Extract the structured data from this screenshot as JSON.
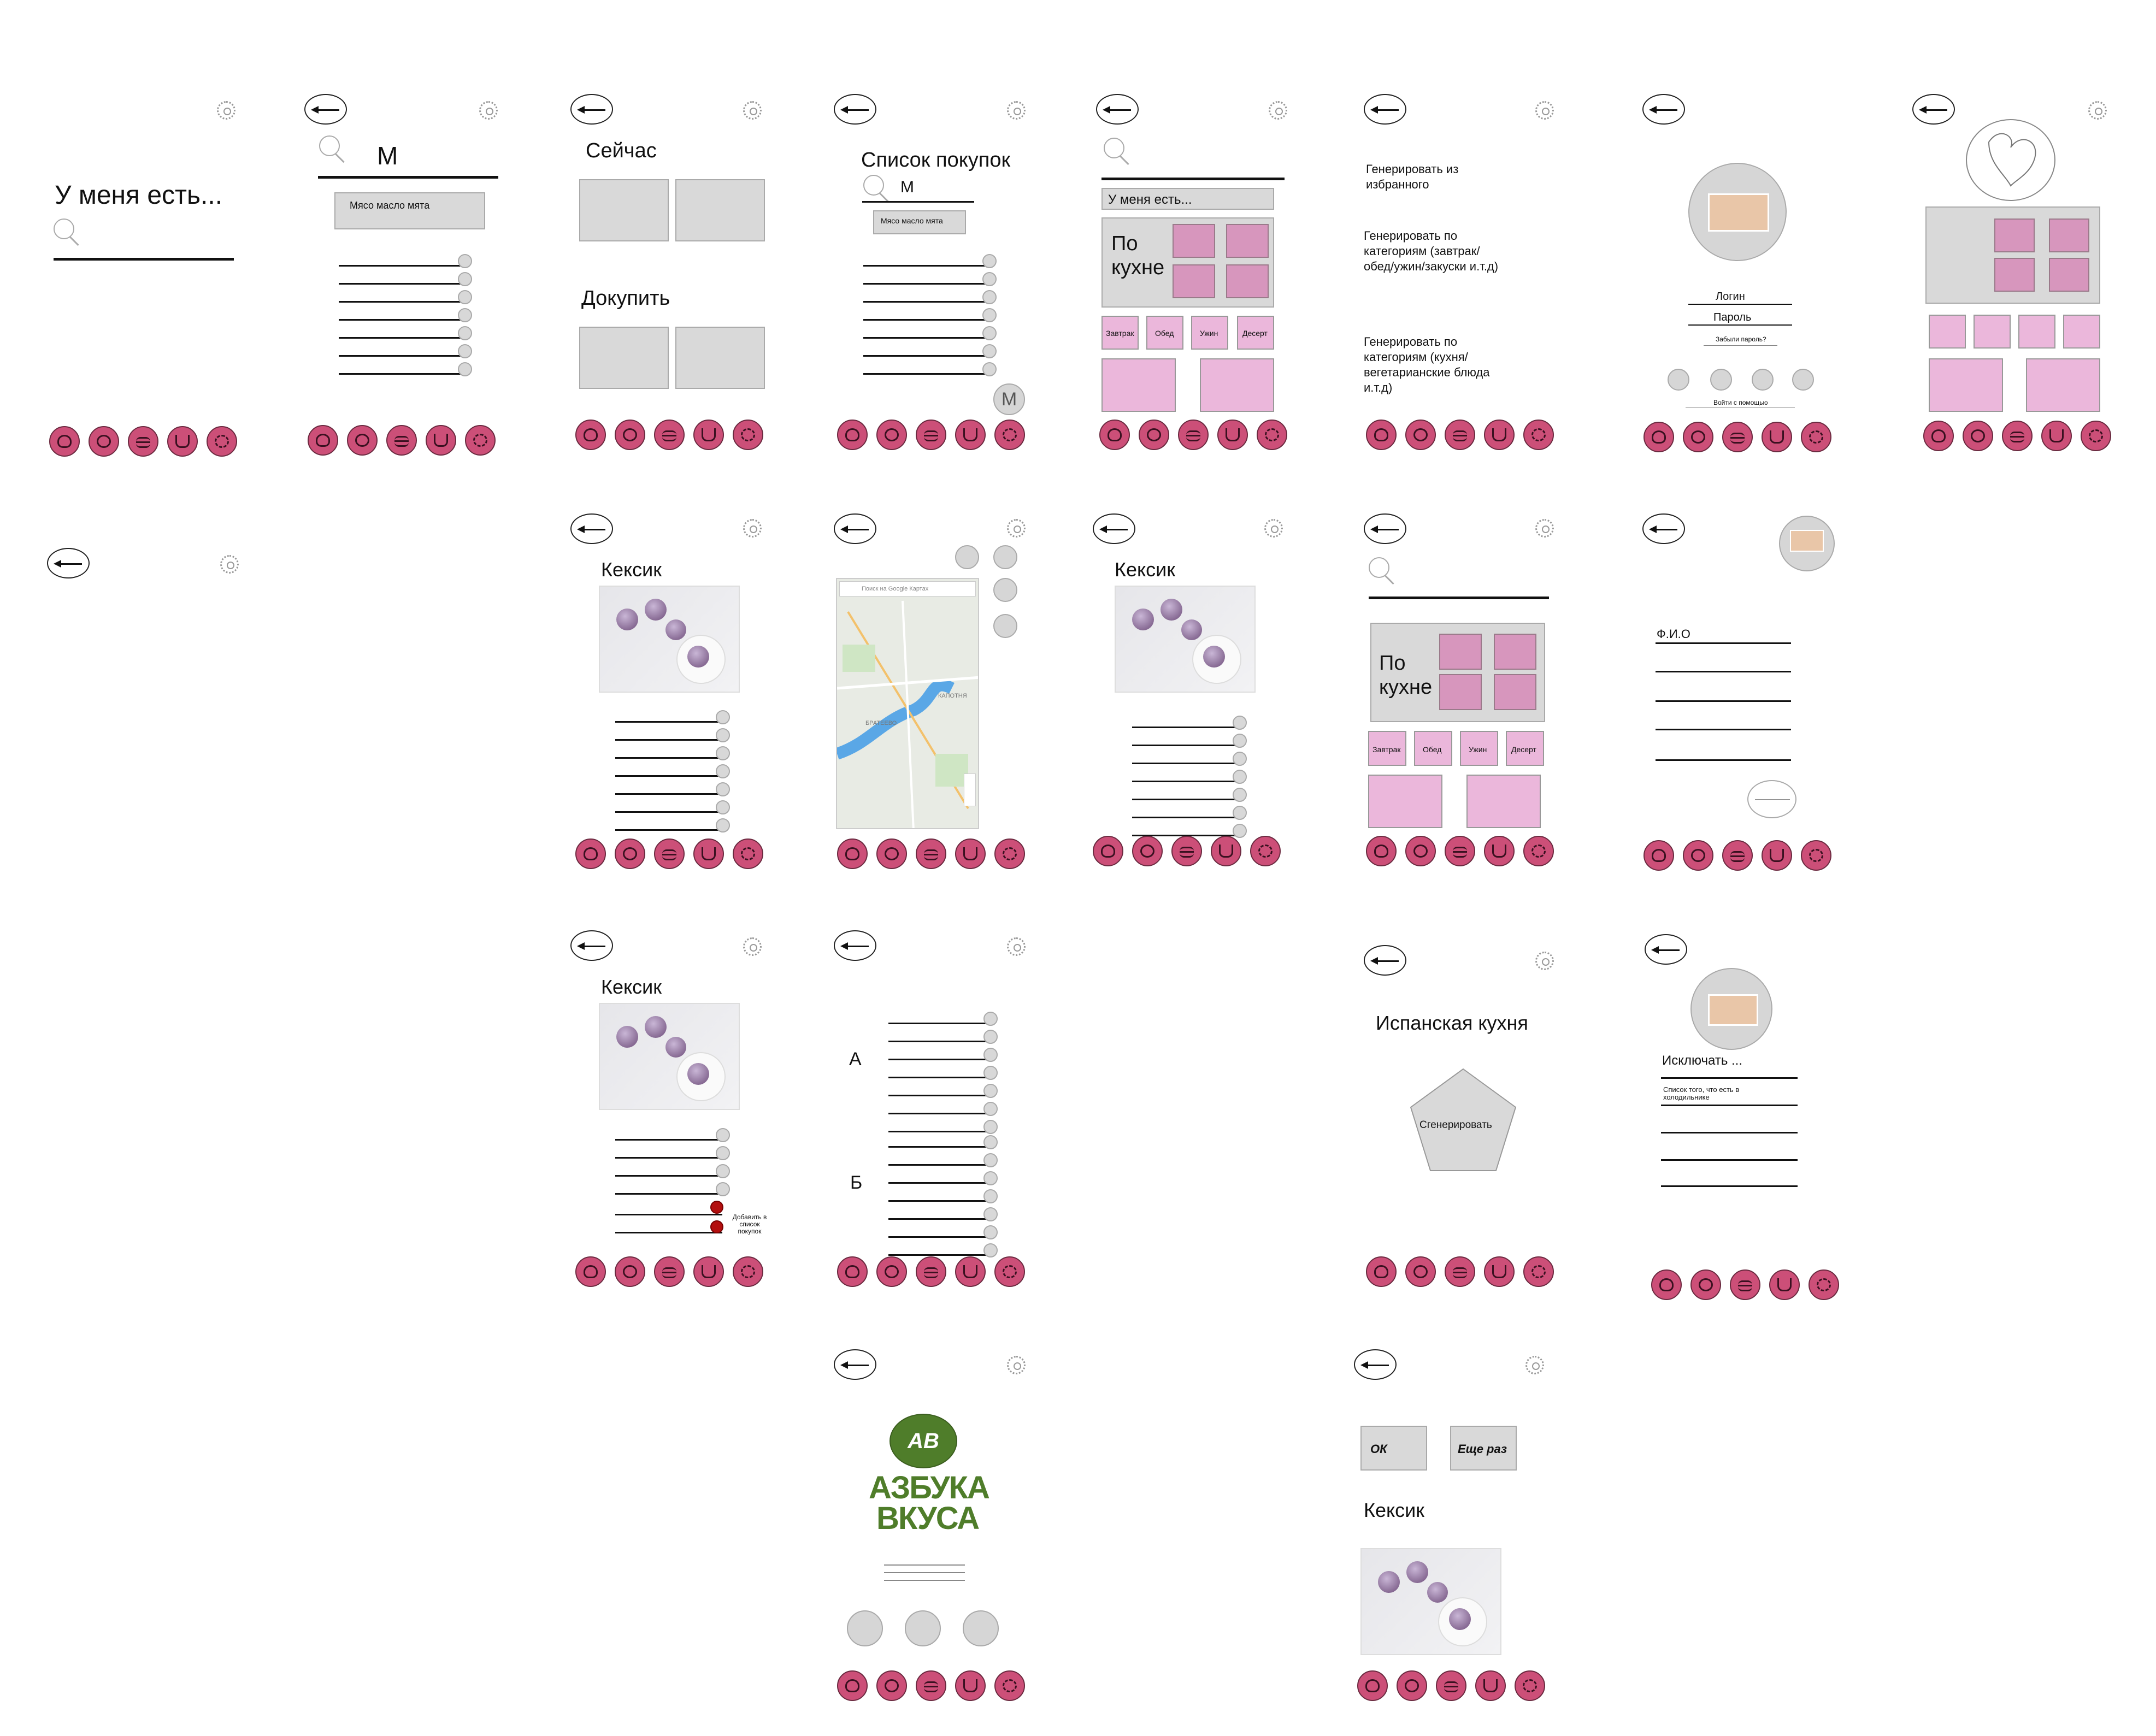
{
  "common": {
    "search_placeholder": "М"
  },
  "s1": {
    "title": "У меня есть..."
  },
  "s2": {
    "query": "М",
    "suggestion": "Мясо масло мята"
  },
  "s3": {
    "now": "Сейчас",
    "buy": "Докупить"
  },
  "s4": {
    "title": "Список покупок",
    "query": "М",
    "suggestion": "Мясо масло мята",
    "fab": "M"
  },
  "s5": {
    "have": "У меня есть...",
    "cuisine": "По кухне",
    "cats": [
      "Завтрак",
      "Обед",
      "Ужин",
      "Десерт"
    ]
  },
  "s6": {
    "g1": "Генерировать из избранного",
    "g2": "Генерировать по категориям (завтрак/ обед/ужин/закуски и.т.д)",
    "g3": "Генерировать по категориям (кухня/ вегетарианские блюда и.т.д)"
  },
  "s7": {
    "login": "Логин",
    "password": "Пароль",
    "forgot": "Забыли пароль?",
    "login_with": "Войти с помощью"
  },
  "r2a": {
    "title": "Кексик"
  },
  "r2b": {
    "map_search": "Поиск на Google Картах",
    "place1": "БРАТЕЕВО",
    "place2": "КАПОТНЯ"
  },
  "r2c": {
    "title": "Кексик"
  },
  "r2d": {
    "cuisine": "По кухне",
    "cats": [
      "Завтрак",
      "Обед",
      "Ужин",
      "Десерт"
    ]
  },
  "r2e": {
    "fio": "Ф.И.О"
  },
  "r3a": {
    "title": "Кексик",
    "add": "Добавить в список покупок"
  },
  "r3b": {
    "a": "А",
    "b": "Б"
  },
  "r3c": {
    "title": "Испанская кухня",
    "generate": "Сгенерировать"
  },
  "r3d": {
    "exclude": "Исключать ...",
    "fridge": "Список того, что есть в холодильнике"
  },
  "r4a": {
    "logo1": "АЗБУКА",
    "logo2": "ВКУСА",
    "mono": "АВ"
  },
  "r4b": {
    "ok": "ОК",
    "again": "Еще раз",
    "title": "Кексик"
  },
  "colors": {
    "nav": "#cc4f78",
    "tile": "#d796bd",
    "tile_light": "#ebb7db",
    "grey": "#d9d9d9",
    "brand_green": "#4f7d2a"
  }
}
